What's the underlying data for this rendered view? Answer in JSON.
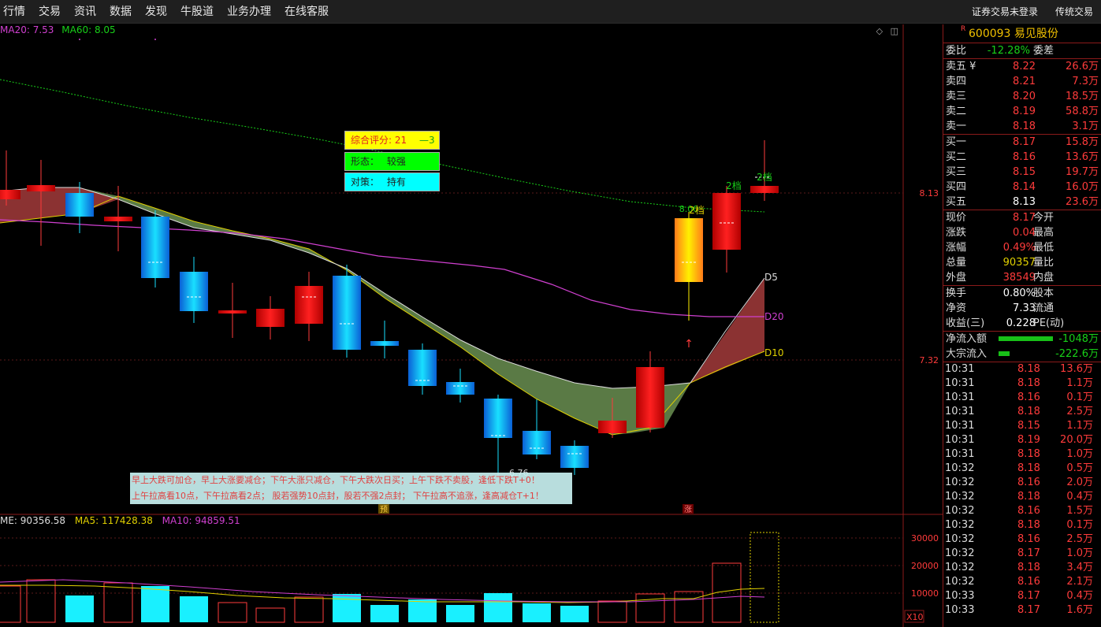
{
  "menu": [
    "行情",
    "交易",
    "资讯",
    "数据",
    "发现",
    "牛股道",
    "业务办理",
    "在线客服"
  ],
  "top_right": {
    "login": "证券交易未登录",
    "mode": "传统交易"
  },
  "legend": {
    "ma20": "MA20: 7.53",
    "ma60": "MA60: 8.05",
    "vol_volume": "ME: 90356.58",
    "vol_ma5": "MA5: 117428.38",
    "vol_ma10": "MA10: 94859.51"
  },
  "eval": {
    "score": "综合评分: 21",
    "score_change": "—3",
    "form_label": "形态：",
    "form_value": "较强",
    "policy_label": "对策：",
    "policy_value": "持有"
  },
  "tips": {
    "line1": "早上大跌可加仓，早上大涨要减仓；下午大涨只减仓，下午大跌次日买；上午下跌不卖股，逢低下跌T+0！",
    "line2": "上午拉高看10点，下午拉高看2点； 股若强势10点封，股若不强2点封； 下午拉高不追涨，逢高减仓T+1！"
  },
  "chart_labels": {
    "d5": "D5",
    "d20": "D20",
    "d10": "D10",
    "level_label": "2档",
    "price_level_high": "8.13",
    "price_level_low": "7.32",
    "low_price": "6.76",
    "marker_pre": "预",
    "marker_up": "涨",
    "vol_ticks": [
      "30000",
      "20000",
      "10000"
    ],
    "vol_scale": "X10",
    "line_tag": "8.00"
  },
  "colors": {
    "up": "#ff3b3b",
    "down": "#18d018",
    "ma20": "#d040d0",
    "ma60": "#18d018",
    "yellow": "#e0d000"
  },
  "stock": {
    "r_mark": "R",
    "code": "600093",
    "name": "易见股份"
  },
  "weibi": {
    "label": "委比",
    "value": "-12.28%",
    "label2": "委差"
  },
  "asks": [
    {
      "label": "卖五 ¥",
      "price": "8.22",
      "vol": "26.6万"
    },
    {
      "label": "卖四",
      "price": "8.21",
      "vol": "7.3万"
    },
    {
      "label": "卖三",
      "price": "8.20",
      "vol": "18.5万"
    },
    {
      "label": "卖二",
      "price": "8.19",
      "vol": "58.8万"
    },
    {
      "label": "卖一",
      "price": "8.18",
      "vol": "3.1万"
    }
  ],
  "bids": [
    {
      "label": "买一",
      "price": "8.17",
      "vol": "15.8万"
    },
    {
      "label": "买二",
      "price": "8.16",
      "vol": "13.6万"
    },
    {
      "label": "买三",
      "price": "8.15",
      "vol": "19.7万"
    },
    {
      "label": "买四",
      "price": "8.14",
      "vol": "16.0万"
    },
    {
      "label": "买五",
      "price": "8.13",
      "vol": "23.6万"
    }
  ],
  "quote": [
    {
      "label": "现价",
      "value": "8.17",
      "label2": "今开"
    },
    {
      "label": "涨跌",
      "value": "0.04",
      "label2": "最高"
    },
    {
      "label": "涨幅",
      "value": "0.49%",
      "label2": "最低"
    },
    {
      "label": "总量",
      "value": "90357",
      "label2": "量比"
    },
    {
      "label": "外盘",
      "value": "38549",
      "label2": "内盘"
    }
  ],
  "fundamentals": [
    {
      "label": "换手",
      "value": "0.80%",
      "label2": "股本"
    },
    {
      "label": "净资",
      "value": "7.33",
      "label2": "流通"
    },
    {
      "label": "收益(三)",
      "value": "0.228",
      "label2": "PE(动)"
    }
  ],
  "flows": [
    {
      "label": "净流入额",
      "value": "-1048万",
      "bar_fraction": 0.5
    },
    {
      "label": "大宗流入",
      "value": "-222.6万",
      "bar_fraction": 0.1
    }
  ],
  "ticks": [
    {
      "t": "10:31",
      "p": "8.18",
      "q": "13.6万"
    },
    {
      "t": "10:31",
      "p": "8.18",
      "q": "1.1万"
    },
    {
      "t": "10:31",
      "p": "8.16",
      "q": "0.1万"
    },
    {
      "t": "10:31",
      "p": "8.18",
      "q": "2.5万"
    },
    {
      "t": "10:31",
      "p": "8.15",
      "q": "1.1万"
    },
    {
      "t": "10:31",
      "p": "8.19",
      "q": "20.0万"
    },
    {
      "t": "10:31",
      "p": "8.18",
      "q": "1.0万"
    },
    {
      "t": "10:32",
      "p": "8.18",
      "q": "0.5万"
    },
    {
      "t": "10:32",
      "p": "8.16",
      "q": "2.0万"
    },
    {
      "t": "10:32",
      "p": "8.18",
      "q": "0.4万"
    },
    {
      "t": "10:32",
      "p": "8.16",
      "q": "1.5万"
    },
    {
      "t": "10:32",
      "p": "8.18",
      "q": "0.1万"
    },
    {
      "t": "10:32",
      "p": "8.16",
      "q": "2.5万"
    },
    {
      "t": "10:32",
      "p": "8.17",
      "q": "1.0万"
    },
    {
      "t": "10:32",
      "p": "8.18",
      "q": "3.4万"
    },
    {
      "t": "10:32",
      "p": "8.16",
      "q": "2.1万"
    },
    {
      "t": "10:33",
      "p": "8.17",
      "q": "0.4万"
    },
    {
      "t": "10:33",
      "p": "8.17",
      "q": "1.6万"
    }
  ]
}
